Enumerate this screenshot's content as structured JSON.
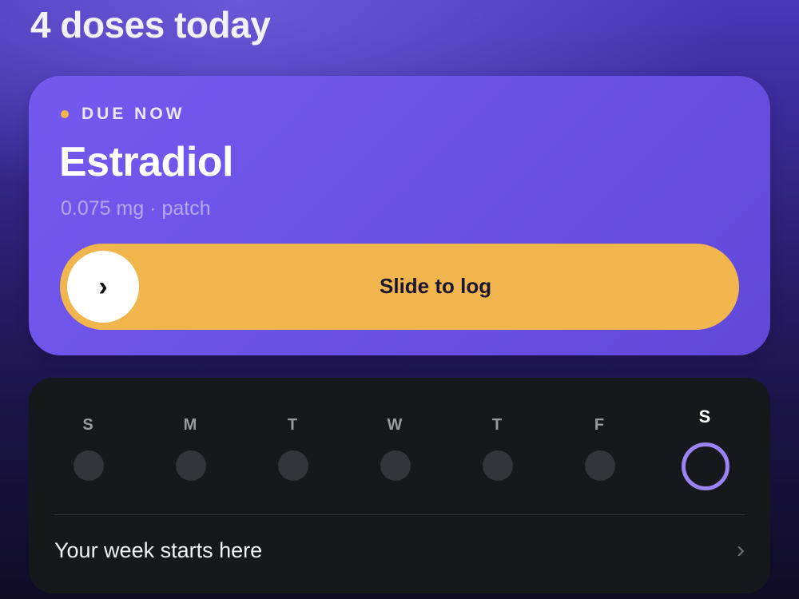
{
  "header": {
    "title": "4 doses today"
  },
  "due_card": {
    "status_label": "DUE NOW",
    "medication_name": "Estradiol",
    "medication_detail": "0.075 mg · patch",
    "slider_label": "Slide to log",
    "slider_thumb_icon": "chevron-right-icon",
    "colors": {
      "card": "#6b52e6",
      "slider": "#f1b54d",
      "status_dot": "#f2b54c"
    }
  },
  "week": {
    "days": [
      {
        "letter": "S",
        "today": false
      },
      {
        "letter": "M",
        "today": false
      },
      {
        "letter": "T",
        "today": false
      },
      {
        "letter": "W",
        "today": false
      },
      {
        "letter": "T",
        "today": false
      },
      {
        "letter": "F",
        "today": false
      },
      {
        "letter": "S",
        "today": true
      }
    ],
    "footer_label": "Your week starts here",
    "footer_icon": "chevron-right-icon",
    "colors": {
      "today_ring": "#9a84f5",
      "day_dot": "#34353b"
    }
  }
}
